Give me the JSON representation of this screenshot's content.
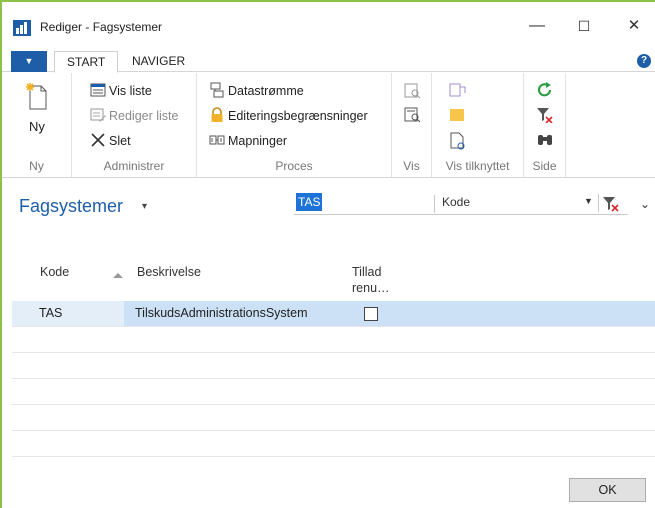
{
  "window": {
    "title": "Rediger - Fagsystemer",
    "controls": {
      "minimize": "—",
      "maximize": "☐",
      "close": "✕"
    }
  },
  "ribbon": {
    "file_menu": "▼",
    "tabs": [
      {
        "label": "START",
        "active": true
      },
      {
        "label": "NAVIGER",
        "active": false
      }
    ],
    "help": "?",
    "groups": {
      "ny": {
        "label": "Ny",
        "new_button": "Ny"
      },
      "administrer": {
        "label": "Administrer",
        "vis_liste": "Vis liste",
        "rediger_liste": "Rediger liste",
        "slet": "Slet"
      },
      "proces": {
        "label": "Proces",
        "datastromme": "Datastrømme",
        "editering": "Editeringsbegrænsninger",
        "mapninger": "Mapninger"
      },
      "vis": {
        "label": "Vis"
      },
      "vis_tilknyttet": {
        "label": "Vis tilknyttet"
      },
      "side": {
        "label": "Side"
      }
    }
  },
  "page": {
    "title": "Fagsystemer",
    "title_caret": "▾",
    "filter": {
      "value": "TAS",
      "field": "Kode",
      "dropdown": "▼"
    },
    "collapse": "⌄"
  },
  "grid": {
    "columns": [
      {
        "key": "kode",
        "label": "Kode"
      },
      {
        "key": "beskrivelse",
        "label": "Beskrivelse"
      },
      {
        "key": "tillad",
        "label": "Tillad renu…"
      }
    ],
    "columns_tillad_line1": "Tillad",
    "columns_tillad_line2": "renu…",
    "rows": [
      {
        "kode": "TAS",
        "beskrivelse": "TilskudsAdministrationsSystem",
        "tillad": false
      }
    ]
  },
  "footer": {
    "ok_label": "OK"
  },
  "colors": {
    "accent": "#1e5ea8",
    "selection": "#cce1f5",
    "border": "#8ec14a"
  }
}
